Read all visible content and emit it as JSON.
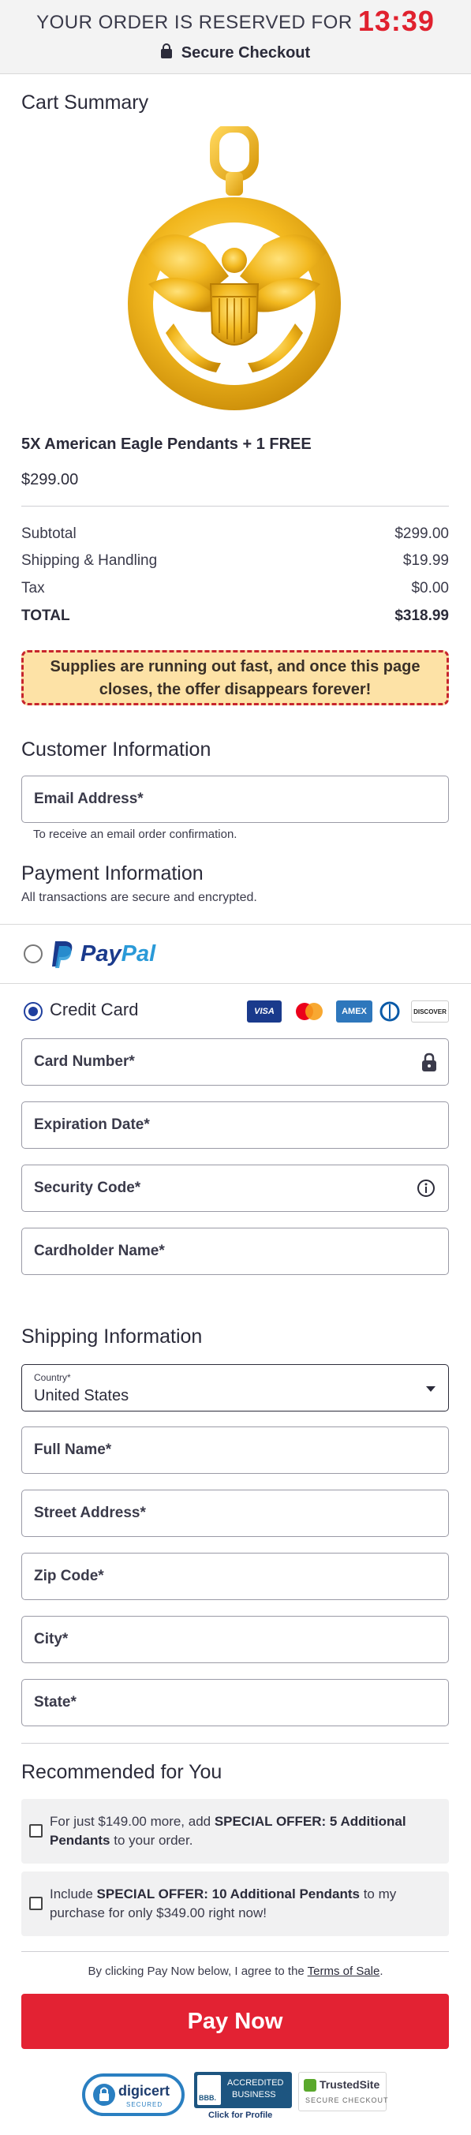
{
  "header": {
    "reserved_text": "YOUR ORDER IS RESERVED FOR",
    "timer": "13:39",
    "secure_checkout": "Secure Checkout"
  },
  "cart": {
    "title": "Cart Summary",
    "product_name": "5X American Eagle Pendants + 1 FREE",
    "product_price": "$299.00",
    "rows": [
      {
        "label": "Subtotal",
        "value": "$299.00"
      },
      {
        "label": "Shipping & Handling",
        "value": "$19.99"
      },
      {
        "label": "Tax",
        "value": "$0.00"
      },
      {
        "label": "TOTAL",
        "value": "$318.99"
      }
    ],
    "alert": "Supplies are running out fast, and once this page closes, the offer disappears forever!"
  },
  "customer": {
    "title": "Customer Information",
    "email_label": "Email Address*",
    "email_note": "To receive an email order confirmation."
  },
  "payment": {
    "title": "Payment Information",
    "subtitle": "All transactions are secure and encrypted.",
    "paypal_pay": "Pay",
    "paypal_pal": "Pal",
    "credit_card": "Credit Card",
    "cards": [
      "VISA",
      "Mastercard",
      "AMEX",
      "Diners",
      "DISCOVER"
    ],
    "fields": [
      "Card Number*",
      "Expiration Date*",
      "Security Code*",
      "Cardholder Name*"
    ]
  },
  "shipping": {
    "title": "Shipping Information",
    "country_label": "Country*",
    "country_value": "United States",
    "fields": [
      "Full Name*",
      "Street Address*",
      "Zip Code*",
      "City*",
      "State*"
    ]
  },
  "recommended": {
    "title": "Recommended for You",
    "offer1": {
      "pre": "For just $149.00 more, add ",
      "bold": "SPECIAL OFFER: 5 Additional Pendants",
      "post": " to your order."
    },
    "offer2": {
      "pre": "Include ",
      "bold": "SPECIAL OFFER: 10 Additional Pendants",
      "post": " to my purchase for only $349.00 right now!"
    }
  },
  "footer": {
    "terms_pre": "By clicking Pay Now below, I agree to the ",
    "terms_link": "Terms of Sale",
    "terms_post": ".",
    "pay_button": "Pay Now",
    "badges": {
      "digicert": "digicert",
      "digicert_sub": "SECURED",
      "bbb_line1": "ACCREDITED",
      "bbb_line2": "BUSINESS",
      "bbb_mark": "BBB.",
      "bbb_click": "Click for Profile",
      "trusted": "TrustedSite",
      "trusted_sub": "SECURE CHECKOUT"
    }
  },
  "colors": {
    "accent_red": "#e32233",
    "timer_red": "#e0212e",
    "radio_blue": "#1f3f9e",
    "alert_bg": "#fde2a6"
  },
  "icons": [
    "lock-icon",
    "eagle-pendant-image",
    "info-icon",
    "paypal-logo",
    "chevron-down-icon"
  ]
}
